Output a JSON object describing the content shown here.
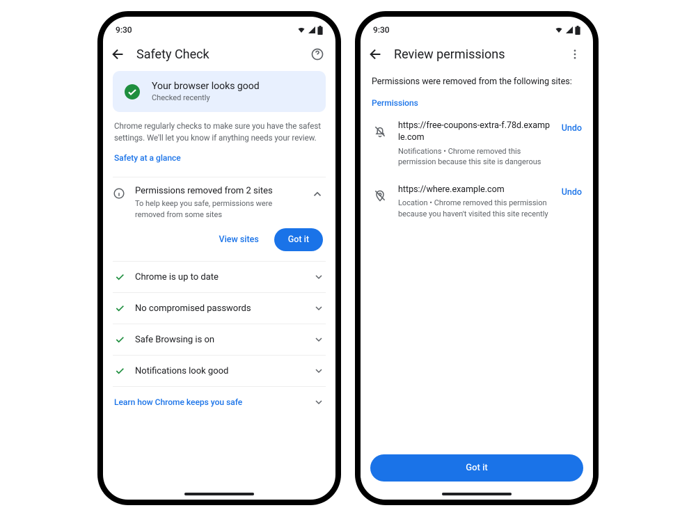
{
  "status_time": "9:30",
  "left": {
    "title": "Safety Check",
    "card": {
      "title": "Your browser looks good",
      "subtitle": "Checked recently"
    },
    "description": "Chrome regularly checks to make sure you have the safest settings. We'll let you know if anything needs your review.",
    "glance_link": "Safety at a glance",
    "permissions": {
      "title": "Permissions removed from 2 sites",
      "subtitle": "To help keep you safe, permissions were removed from some sites",
      "view_label": "View sites",
      "got_it_label": "Got it"
    },
    "checks": [
      "Chrome is up to date",
      "No compromised passwords",
      "Safe Browsing is on",
      "Notifications look good"
    ],
    "learn_link": "Learn how Chrome keeps you safe"
  },
  "right": {
    "title": "Review permissions",
    "intro": "Permissions were removed from the following sites:",
    "section_label": "Permissions",
    "sites": [
      {
        "icon": "notification-off",
        "url": "https://free-coupons-extra-f.78d.example.com",
        "desc": "Notifications • Chrome removed this permission because this site is dangerous"
      },
      {
        "icon": "location-off",
        "url": "https://where.example.com",
        "desc": "Location • Chrome removed this permission because you haven't visited this site recently"
      }
    ],
    "undo_label": "Undo",
    "got_it_label": "Got it"
  }
}
